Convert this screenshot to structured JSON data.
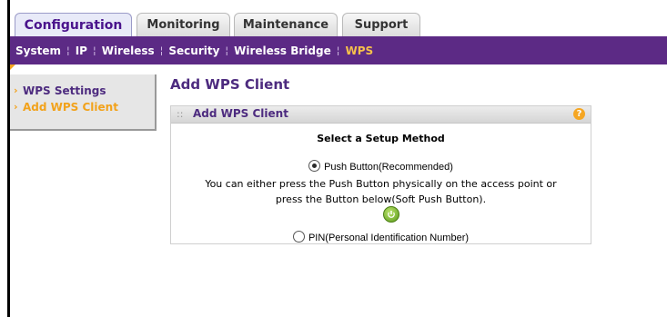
{
  "tabs": [
    {
      "label": "Configuration",
      "active": true
    },
    {
      "label": "Monitoring",
      "active": false
    },
    {
      "label": "Maintenance",
      "active": false
    },
    {
      "label": "Support",
      "active": false
    }
  ],
  "subnav": {
    "items": [
      "System",
      "IP",
      "Wireless",
      "Security",
      "Wireless Bridge",
      "WPS"
    ],
    "active": "WPS"
  },
  "leftmenu": {
    "items": [
      {
        "label": "WPS Settings",
        "active": false
      },
      {
        "label": "Add WPS Client",
        "active": true
      }
    ]
  },
  "page": {
    "title": "Add WPS Client"
  },
  "panel": {
    "title": "Add WPS Client",
    "help_icon": "question-icon",
    "setup_heading": "Select a Setup Method",
    "option_push_label": "Push Button(Recommended)",
    "option_push_selected": true,
    "description_line1": "You can either press the Push Button physically on the access point or",
    "description_line2": "press the Button below(Soft Push Button).",
    "push_button_icon": "wps-push-icon",
    "option_pin_label": "PIN(Personal Identification Number)",
    "option_pin_selected": false
  },
  "colors": {
    "accent_purple": "#5c2a85",
    "accent_orange": "#f2a21b",
    "text_purple": "#4d2b7f"
  }
}
